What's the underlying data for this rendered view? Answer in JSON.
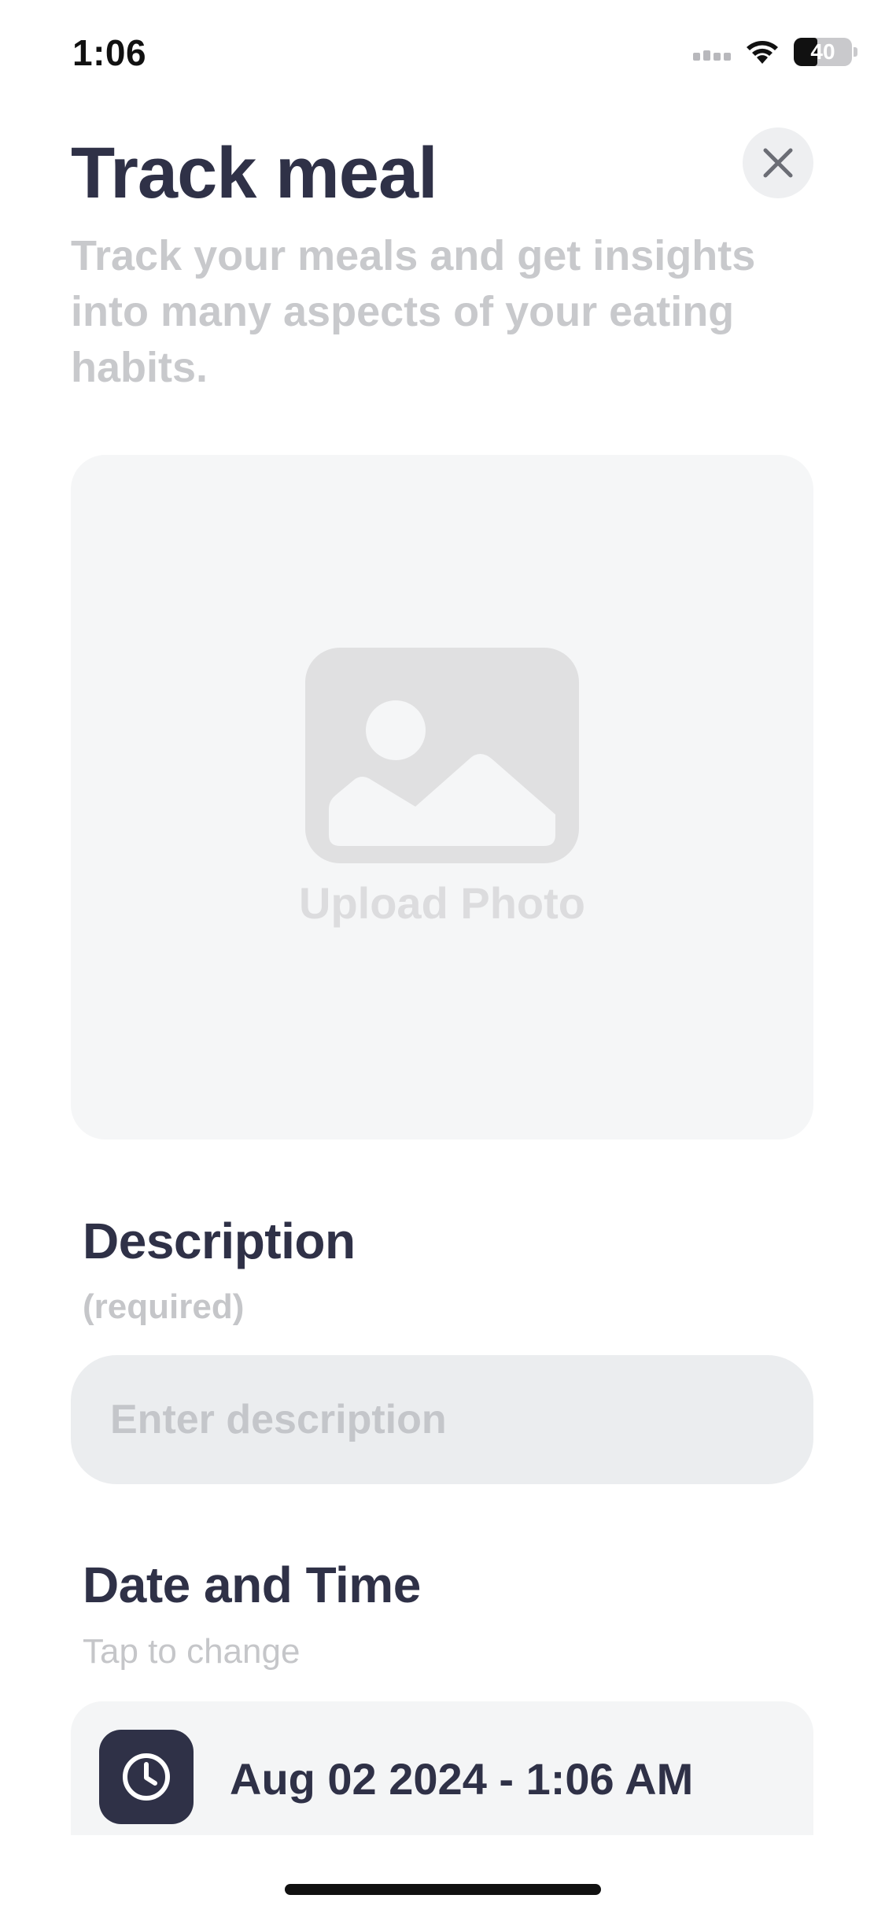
{
  "status_bar": {
    "time": "1:06",
    "battery": "40",
    "battery_level": 0.4
  },
  "header": {
    "title": "Track meal",
    "subtitle": "Track your meals and get insights into many aspects of your eating habits."
  },
  "upload": {
    "label": "Upload Photo"
  },
  "description": {
    "title": "Description",
    "subtitle": "(required)",
    "placeholder": "Enter description"
  },
  "date_time": {
    "title": "Date and Time",
    "subtitle": "Tap to change",
    "value": "Aug 02 2024 - 1:06 AM"
  },
  "colors": {
    "text_dark": "#2f3147",
    "muted": "#c8c9cc",
    "card_bg": "#f5f6f7",
    "input_bg": "#ebedef"
  }
}
